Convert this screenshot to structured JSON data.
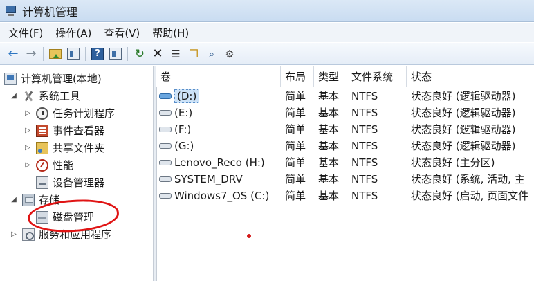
{
  "window": {
    "title": "计算机管理"
  },
  "menu": {
    "items": [
      "文件(F)",
      "操作(A)",
      "查看(V)",
      "帮助(H)"
    ]
  },
  "toolbar": {
    "icons": [
      "back-arrow-icon",
      "forward-arrow-icon",
      "up-folder-icon",
      "show-hide-tree-icon",
      "help-icon",
      "show-hide-action-pane-icon",
      "refresh-icon",
      "delete-icon",
      "properties-icon",
      "open-folder-icon",
      "search-icon",
      "settings-icon"
    ]
  },
  "tree": {
    "root": "计算机管理(本地)",
    "system_tools": "系统工具",
    "task_scheduler": "任务计划程序",
    "event_viewer": "事件查看器",
    "shared_folders": "共享文件夹",
    "performance": "性能",
    "device_manager": "设备管理器",
    "storage": "存储",
    "disk_management": "磁盘管理",
    "services_apps": "服务和应用程序"
  },
  "table": {
    "headers": [
      "卷",
      "布局",
      "类型",
      "文件系统",
      "状态"
    ],
    "rows": [
      {
        "volume": "(D:)",
        "layout": "简单",
        "type": "基本",
        "fs": "NTFS",
        "status": "状态良好 (逻辑驱动器)"
      },
      {
        "volume": "(E:)",
        "layout": "简单",
        "type": "基本",
        "fs": "NTFS",
        "status": "状态良好 (逻辑驱动器)"
      },
      {
        "volume": "(F:)",
        "layout": "简单",
        "type": "基本",
        "fs": "NTFS",
        "status": "状态良好 (逻辑驱动器)"
      },
      {
        "volume": "(G:)",
        "layout": "简单",
        "type": "基本",
        "fs": "NTFS",
        "status": "状态良好 (逻辑驱动器)"
      },
      {
        "volume": "Lenovo_Reco (H:)",
        "layout": "简单",
        "type": "基本",
        "fs": "NTFS",
        "status": "状态良好 (主分区)"
      },
      {
        "volume": "SYSTEM_DRV",
        "layout": "简单",
        "type": "基本",
        "fs": "NTFS",
        "status": "状态良好 (系统, 活动, 主"
      },
      {
        "volume": "Windows7_OS (C:)",
        "layout": "简单",
        "type": "基本",
        "fs": "NTFS",
        "status": "状态良好 (启动, 页面文件"
      }
    ]
  },
  "annotation": {
    "highlight_color": "#e01414"
  }
}
